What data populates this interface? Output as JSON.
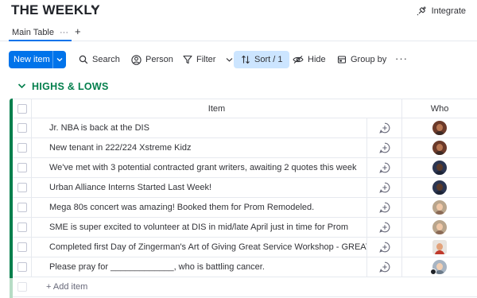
{
  "header": {
    "title": "THE WEEKLY",
    "integrate_label": "Integrate"
  },
  "tabs": {
    "main_label": "Main Table",
    "more": "···",
    "add": "+"
  },
  "toolbar": {
    "new_item": "New item",
    "search": "Search",
    "person": "Person",
    "filter": "Filter",
    "sort": "Sort / 1",
    "hide": "Hide",
    "group_by": "Group by",
    "more": "···"
  },
  "group": {
    "title": "HIGHS & LOWS",
    "color": "#037f4c",
    "columns": {
      "item": "Item",
      "who": "Who"
    },
    "rows": [
      {
        "item": "Jr. NBA is back at the DIS",
        "avatar": "female-1"
      },
      {
        "item": "New tenant in 222/224 Xstreme Kidz",
        "avatar": "female-1"
      },
      {
        "item": "We've met with 3 potential contracted grant writers, awaiting 2 quotes this week",
        "avatar": "male-1"
      },
      {
        "item": "Urban Alliance Interns Started Last Week!",
        "avatar": "male-1"
      },
      {
        "item": "Mega 80s concert was amazing! Booked them for Prom Remodeled.",
        "avatar": "female-2"
      },
      {
        "item": "SME is super excited to volunteer at DIS in mid/late April just in time for Prom",
        "avatar": "female-2"
      },
      {
        "item": "Completed first Day of Zingerman's Art of Giving Great Service Workshop - GREAT!",
        "avatar": "male-2"
      },
      {
        "item": "Please pray for _____________, who is battling cancer.",
        "avatar": "female-3"
      }
    ],
    "add_item": "+ Add item"
  },
  "colors": {
    "accent": "#0073ea",
    "sort_active": "#cce5ff",
    "group": "#037f4c"
  }
}
